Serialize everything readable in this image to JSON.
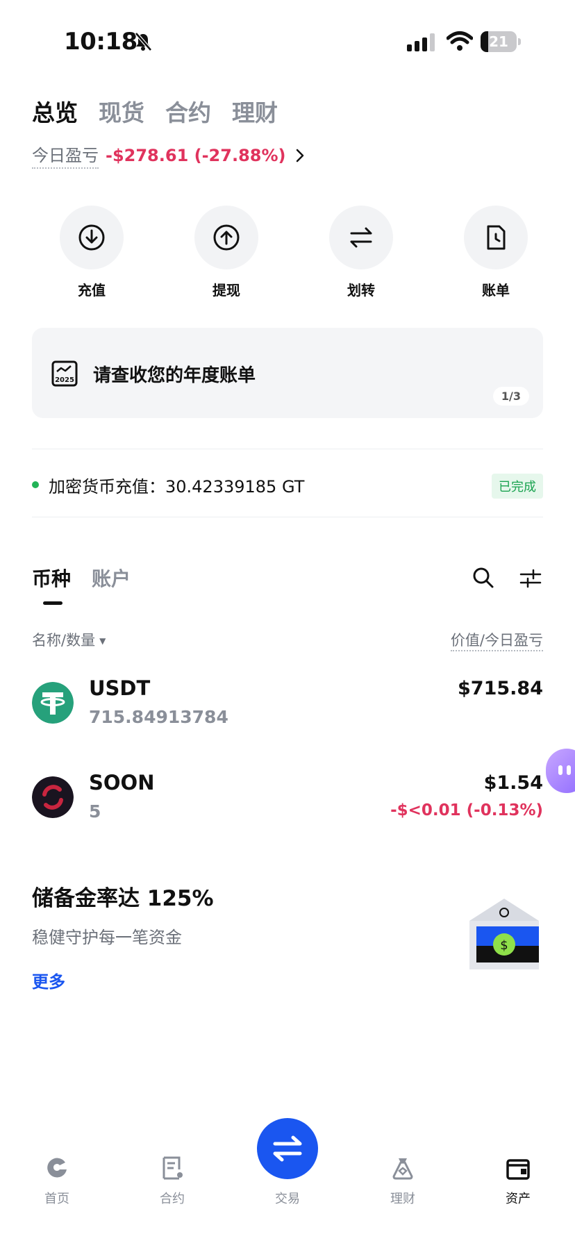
{
  "status_bar": {
    "time": "10:18",
    "battery_percent": "21",
    "battery_level": 0.21
  },
  "top_tabs": [
    {
      "label": "总览",
      "active": true
    },
    {
      "label": "现货",
      "active": false
    },
    {
      "label": "合约",
      "active": false
    },
    {
      "label": "理财",
      "active": false
    }
  ],
  "pnl": {
    "label": "今日盈亏",
    "value": "-$278.61 (-27.88%)"
  },
  "actions": [
    {
      "label": "充值",
      "icon": "deposit-icon"
    },
    {
      "label": "提现",
      "icon": "withdraw-icon"
    },
    {
      "label": "划转",
      "icon": "transfer-icon"
    },
    {
      "label": "账单",
      "icon": "bill-icon"
    }
  ],
  "banner": {
    "text": "请查收您的年度账单",
    "pager": "1/3",
    "icon_year": "2025"
  },
  "notice": {
    "text": "加密货币充值：30.42339185 GT",
    "badge": "已完成"
  },
  "asset_tabs": [
    {
      "label": "币种",
      "active": true
    },
    {
      "label": "账户",
      "active": false
    }
  ],
  "list_header": {
    "left": "名称/数量",
    "right": "价值/今日盈亏"
  },
  "coins": [
    {
      "name": "USDT",
      "quantity": "715.84913784",
      "value": "$715.84",
      "pnl": ""
    },
    {
      "name": "SOON",
      "quantity": "5",
      "value": "$1.54",
      "pnl": "-$<0.01 (-0.13%)"
    }
  ],
  "reserve": {
    "title": "储备金率达 125%",
    "subtitle": "稳健守护每一笔资金",
    "more": "更多"
  },
  "bottom_nav": [
    {
      "label": "首页",
      "icon": "home-icon",
      "active": false
    },
    {
      "label": "合约",
      "icon": "futures-icon",
      "active": false
    },
    {
      "label": "交易",
      "icon": "trade-icon",
      "active": false
    },
    {
      "label": "理财",
      "icon": "earn-icon",
      "active": false
    },
    {
      "label": "资产",
      "icon": "wallet-icon",
      "active": true
    }
  ],
  "colors": {
    "loss": "#e0335d",
    "brand": "#1a56f0",
    "success": "#1aa350",
    "usdt": "#26a17b"
  }
}
